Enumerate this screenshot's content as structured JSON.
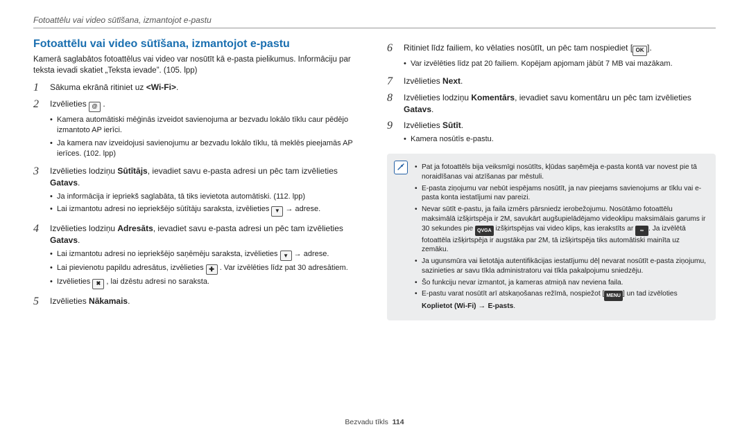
{
  "running_header": "Fotoattēlu vai video sūtīšana, izmantojot e-pastu",
  "section_title": "Fotoattēlu vai video sūtīšana, izmantojot e-pastu",
  "intro": "Kamerā saglabātos fotoattēlus vai video var nosūtīt kā e-pasta pielikumus. Informāciju par teksta ievadi skatiet „Teksta ievade”. (105. lpp)",
  "left_steps": [
    {
      "num": "1",
      "html": "Sākuma ekrānā ritiniet uz <b class='angle'>&lt;Wi-Fi&gt;</b>."
    },
    {
      "num": "2",
      "html": "Izvēlieties <span class='iconbox' data-name='email-app-icon' data-interactable='false'>@</span> .",
      "subs": [
        "Kamera automātiski mēģinās izveidot savienojuma ar bezvadu lokālo tīklu caur pēdējo izmantoto AP ierīci.",
        "Ja kamera nav izveidojusi savienojumu ar bezvadu lokālo tīklu, tā meklēs pieejamās AP ierīces. (102. lpp)"
      ]
    },
    {
      "num": "3",
      "html": "Izvēlieties lodziņu <b>Sūtītājs</b>, ievadiet savu e-pasta adresi un pēc tam izvēlieties <b>Gatavs</b>.",
      "subs": [
        "Ja informācija ir iepriekš saglabāta, tā tiks ievietota automātiski. (112. lpp)",
        "Lai izmantotu adresi no iepriekšējo sūtītāju saraksta, izvēlieties <span class='iconbox arrow-down' data-name='down-arrow-icon' data-interactable='false'></span> <span class='arrow-right' data-name='arrow-right-icon' data-interactable='false'></span> adrese."
      ]
    },
    {
      "num": "4",
      "html": "Izvēlieties lodziņu <b>Adresāts</b>, ievadiet savu e-pasta adresi un pēc tam izvēlieties <b>Gatavs</b>.",
      "subs": [
        "Lai izmantotu adresi no iepriekšējo saņēmēju saraksta, izvēlieties <span class='iconbox arrow-down' data-name='down-arrow-icon' data-interactable='false'></span> <span class='arrow-right' data-name='arrow-right-icon' data-interactable='false'></span> adrese.",
        "Lai pievienotu papildu adresātus, izvēlieties <span class='iconbox plus' data-name='plus-icon' data-interactable='false'></span> . Var izvēlēties līdz pat 30 adresātiem.",
        "Izvēlieties <span class='iconbox cross' data-name='cross-icon' data-interactable='false'></span> , lai dzēstu adresi no saraksta."
      ]
    },
    {
      "num": "5",
      "html": "Izvēlieties <b>Nākamais</b>."
    }
  ],
  "right_steps": [
    {
      "num": "6",
      "html": "Ritiniet līdz failiem, ko vēlaties nosūtīt, un pēc tam nospiediet [<span class='iconbox ok' data-name='ok-button-icon' data-interactable='false'>OK</span>].",
      "subs": [
        "Var izvēlēties līdz pat 20 failiem. Kopējam apjomam jābūt 7 MB vai mazākam."
      ]
    },
    {
      "num": "7",
      "html": "Izvēlieties <b>Next</b>."
    },
    {
      "num": "8",
      "html": "Izvēlieties lodziņu <b>Komentārs</b>, ievadiet savu komentāru un pēc tam izvēlieties <b>Gatavs</b>."
    },
    {
      "num": "9",
      "html": "Izvēlieties <b>Sūtīt</b>.",
      "subs": [
        "Kamera nosūtīs e-pastu."
      ]
    }
  ],
  "notes": [
    "Pat ja fotoattēls bija veiksmīgi nosūtīts, kļūdas saņēmēja e-pasta kontā var novest pie tā noraidīšanas vai atzīšanas par mēstuli.",
    "E-pasta ziņojumu var nebūt iespējams nosūtīt, ja nav pieejams savienojums ar tīklu vai e-pasta konta iestatījumi nav pareizi.",
    "Nevar sūtīt e-pastu, ja faila izmērs pārsniedz ierobežojumu. Nosūtāmo fotoattēlu maksimālā izšķirtspēja ir 2M, savukārt augšupielādējamo videoklipu maksimālais garums ir 30 sekundes pie <span class='iconbox dark' data-name='qvga-icon' data-interactable='false'>QVGA</span> izšķirtspējas vai video klips, kas ierakstīts ar <span class='iconbox dark' data-name='share-rec-icon' data-interactable='false'>∞</span>. Ja izvēlētā fotoattēla izšķirtspēja ir augstāka par 2M, tā izšķirtspēja tiks automātiski mainīta uz zemāku.",
    "Ja ugunsmūra vai lietotāja autentifikācijas iestatījumu dēļ nevarat nosūtīt e-pasta ziņojumu, sazinieties ar savu tīkla administratoru vai tīkla pakalpojumu sniedzēju.",
    "Šo funkciju nevar izmantot, ja kameras atmiņā nav neviena faila.",
    "E-pastu varat nosūtīt arī atskaņošanas režīmā, nospiežot [<span class='iconbox dark' data-name='menu-icon' data-interactable='false'>MENU</span>] un tad izvēloties <b>Koplietot (Wi-Fi)</b> <span class='arrow-right' data-name='arrow-right-icon' data-interactable='false'></span> <b>E-pasts</b>."
  ],
  "footer_section": "Bezvadu tīkls",
  "footer_page": "114"
}
